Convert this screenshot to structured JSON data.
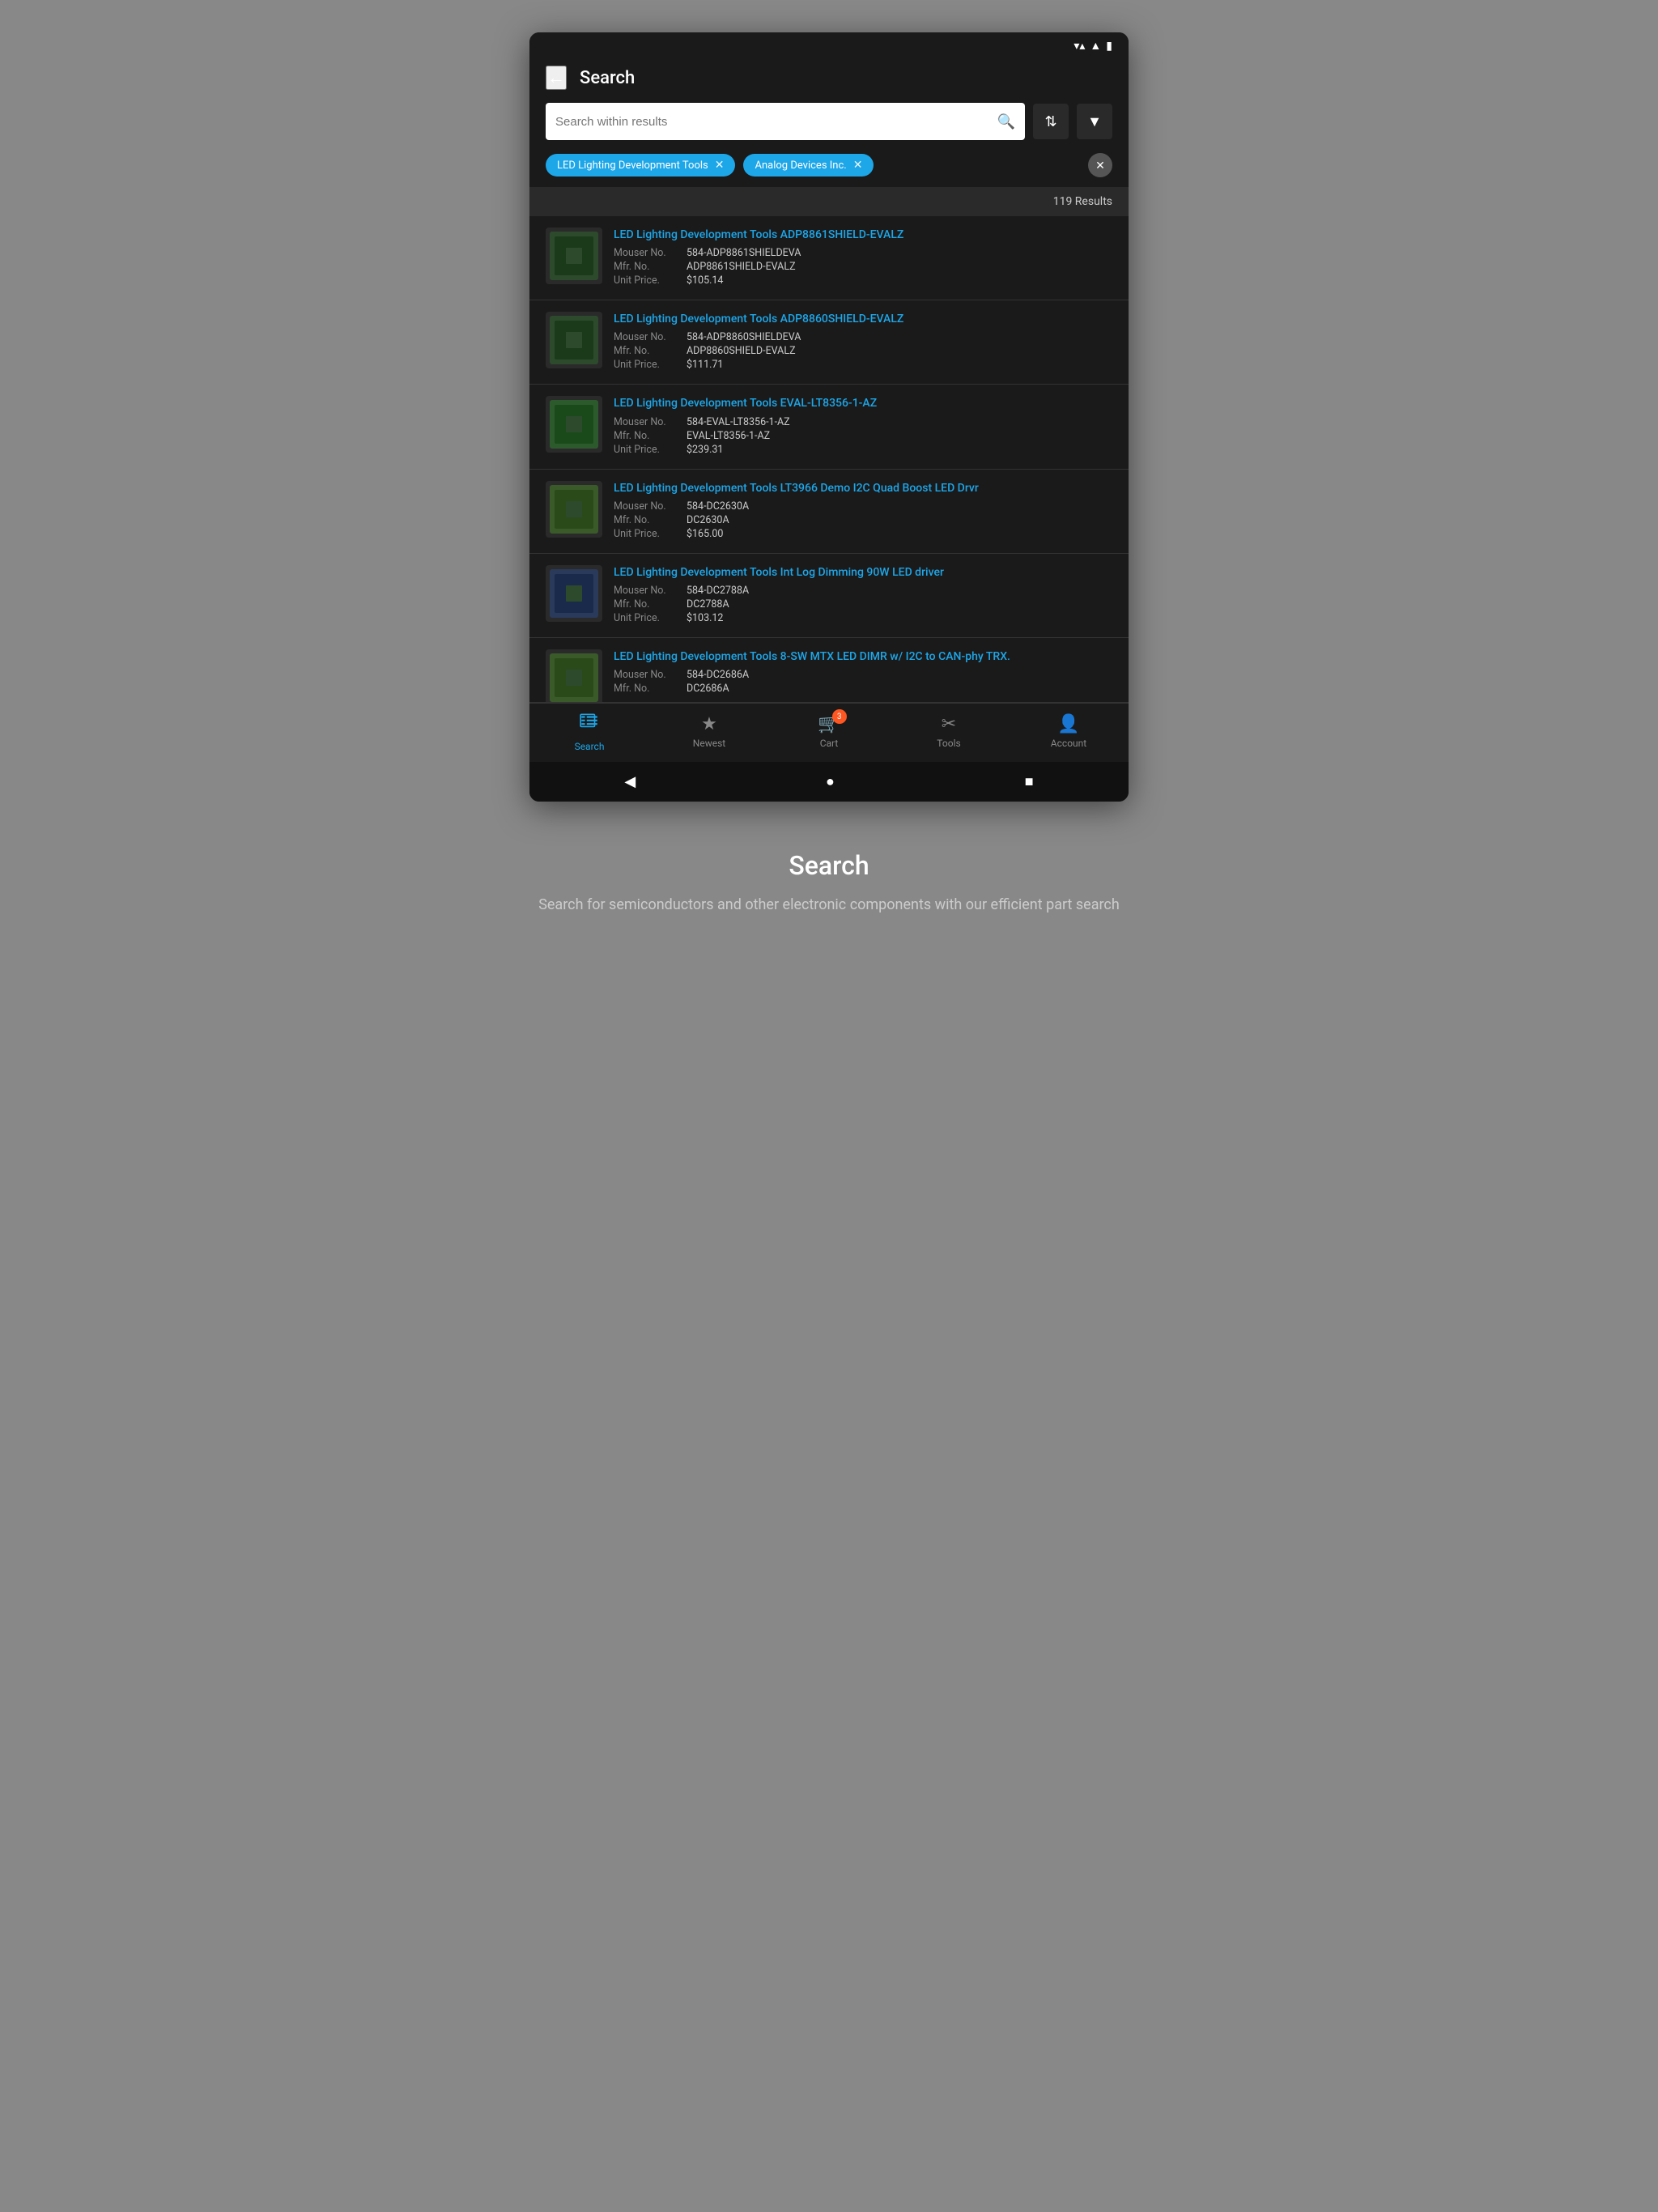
{
  "statusBar": {
    "wifi": "▼",
    "signal": "▲",
    "battery": "🔋"
  },
  "header": {
    "backLabel": "←",
    "title": "Search"
  },
  "searchBar": {
    "placeholder": "Search within results",
    "sortIcon": "⇅",
    "filterIcon": "▼"
  },
  "chips": [
    {
      "id": "chip1",
      "label": "LED Lighting Development Tools",
      "x": "✕"
    },
    {
      "id": "chip2",
      "label": "Analog Devices Inc.",
      "x": "✕"
    }
  ],
  "clearAllLabel": "✕",
  "results": {
    "count": "119 Results"
  },
  "products": [
    {
      "id": "p1",
      "title": "LED Lighting Development Tools ADP8861SHIELD-EVALZ",
      "mouserNo": "584-ADP8861SHIELDEVA",
      "mfrNo": "ADP8861SHIELD-EVALZ",
      "unitPrice": "$105.14"
    },
    {
      "id": "p2",
      "title": "LED Lighting Development Tools ADP8860SHIELD-EVALZ",
      "mouserNo": "584-ADP8860SHIELDEVA",
      "mfrNo": "ADP8860SHIELD-EVALZ",
      "unitPrice": "$111.71"
    },
    {
      "id": "p3",
      "title": "LED Lighting Development Tools EVAL-LT8356-1-AZ",
      "mouserNo": "584-EVAL-LT8356-1-AZ",
      "mfrNo": "EVAL-LT8356-1-AZ",
      "unitPrice": "$239.31"
    },
    {
      "id": "p4",
      "title": "LED Lighting Development Tools LT3966 Demo I2C Quad Boost LED Drvr",
      "mouserNo": "584-DC2630A",
      "mfrNo": "DC2630A",
      "unitPrice": "$165.00"
    },
    {
      "id": "p5",
      "title": "LED Lighting Development Tools Int Log Dimming 90W LED driver",
      "mouserNo": "584-DC2788A",
      "mfrNo": "DC2788A",
      "unitPrice": "$103.12"
    },
    {
      "id": "p6",
      "title": "LED Lighting Development Tools 8-SW MTX LED DIMR w/ I2C to CAN-phy TRX.",
      "mouserNo": "584-DC2686A",
      "mfrNo": "DC2686A",
      "unitPrice": ""
    }
  ],
  "labels": {
    "mouserNo": "Mouser No.",
    "mfrNo": "Mfr. No.",
    "unitPrice": "Unit Price."
  },
  "bottomNav": [
    {
      "id": "search",
      "label": "Search",
      "active": true
    },
    {
      "id": "newest",
      "label": "Newest",
      "active": false
    },
    {
      "id": "cart",
      "label": "Cart",
      "active": false,
      "badge": "3"
    },
    {
      "id": "tools",
      "label": "Tools",
      "active": false
    },
    {
      "id": "account",
      "label": "Account",
      "active": false
    }
  ],
  "androidNav": {
    "back": "◀",
    "home": "●",
    "recent": "■"
  },
  "bottomSection": {
    "title": "Search",
    "subtitle": "Search for semiconductors and other electronic components with our efficient part search"
  }
}
